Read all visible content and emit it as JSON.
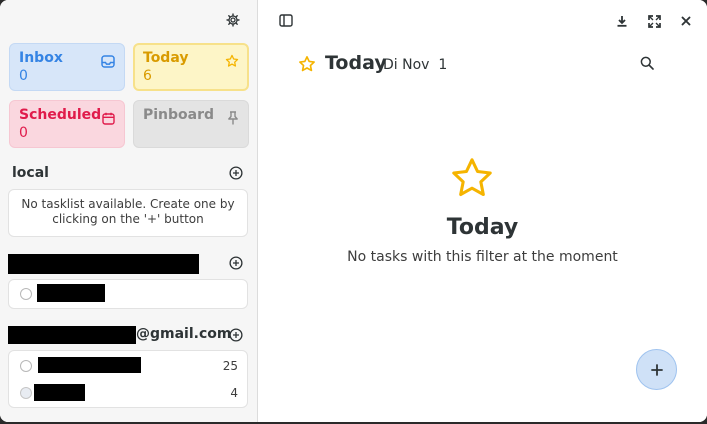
{
  "sidebar": {
    "filters": {
      "inbox": {
        "label": "Inbox",
        "count": "0"
      },
      "today": {
        "label": "Today",
        "count": "6"
      },
      "scheduled": {
        "label": "Scheduled",
        "count": "0"
      },
      "pinboard": {
        "label": "Pinboard"
      }
    },
    "sources": [
      {
        "name": "local",
        "empty_message": "No tasklist available. Create one by clicking on the '+' button"
      },
      {
        "name": "",
        "lists": [
          {
            "name": "",
            "count": ""
          }
        ]
      },
      {
        "name_suffix": "@gmail.com",
        "lists": [
          {
            "name": "",
            "count": "25"
          },
          {
            "name": "",
            "count": "4"
          }
        ]
      }
    ]
  },
  "main": {
    "title": "Today",
    "date": "Di Nov  1",
    "empty_state": {
      "title": "Today",
      "message": "No tasks with this filter at the moment"
    }
  },
  "colors": {
    "inbox": "#3584e4",
    "today": "#f5b400",
    "scheduled": "#e01b4b",
    "pinboard": "#8a8a8a",
    "accent": "#3584e4"
  },
  "icons": {
    "settings": "gear-icon",
    "sidebar_toggle": "sidebar-toggle-icon",
    "download": "download-icon",
    "fullscreen": "fullscreen-icon",
    "close": "close-icon",
    "search": "search-icon",
    "add": "plus-icon"
  }
}
